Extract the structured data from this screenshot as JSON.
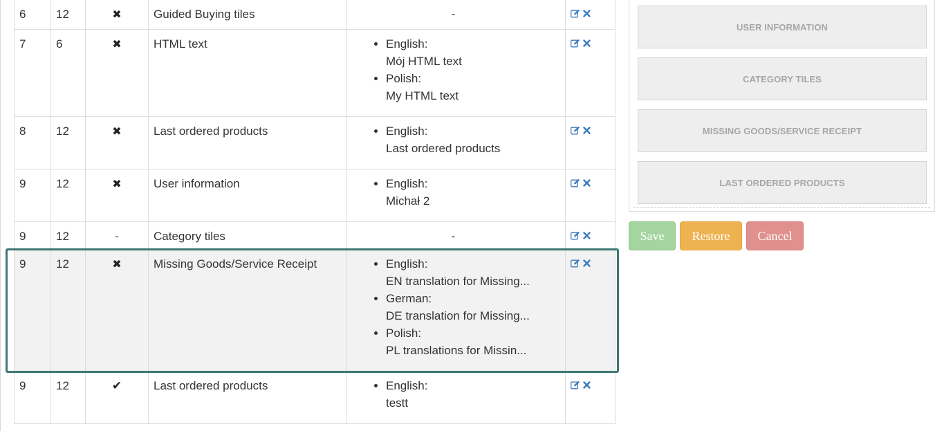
{
  "table": {
    "rows": [
      {
        "order": "6",
        "width": "12",
        "visible": "cross",
        "name": "Guided Buying tiles",
        "translations": [],
        "empty_text": "-"
      },
      {
        "order": "7",
        "width": "6",
        "visible": "cross",
        "name": "HTML text",
        "translations": [
          {
            "lang": "English:",
            "text": "Mój HTML text"
          },
          {
            "lang": "Polish:",
            "text": "My HTML text"
          }
        ]
      },
      {
        "order": "8",
        "width": "12",
        "visible": "cross",
        "name": "Last ordered products",
        "translations": [
          {
            "lang": "English:",
            "text": "Last ordered products"
          }
        ]
      },
      {
        "order": "9",
        "width": "12",
        "visible": "cross",
        "name": "User information",
        "translations": [
          {
            "lang": "English:",
            "text": "Michał 2"
          }
        ]
      },
      {
        "order": "9",
        "width": "12",
        "visible": "-",
        "name": "Category tiles",
        "translations": [],
        "empty_text": "-"
      },
      {
        "order": "9",
        "width": "12",
        "visible": "cross",
        "name": "Missing Goods/Service Receipt",
        "selected": true,
        "translations": [
          {
            "lang": "English:",
            "text": "EN translation for Missing..."
          },
          {
            "lang": "German:",
            "text": "DE translation for Missing..."
          },
          {
            "lang": "Polish:",
            "text": "PL translations for Missin..."
          }
        ]
      },
      {
        "order": "9",
        "width": "12",
        "visible": "check",
        "name": "Last ordered products",
        "translations": [
          {
            "lang": "English:",
            "text": "testt"
          }
        ]
      }
    ],
    "icons": {
      "edit": "edit-icon",
      "delete": "delete-icon",
      "cross": "cross-icon",
      "check": "check-icon"
    },
    "colors": {
      "icon_blue": "#3a7bbf",
      "highlight": "#3e7774"
    }
  },
  "panel": {
    "tiles": [
      "USER INFORMATION",
      "CATEGORY TILES",
      "MISSING GOODS/SERVICE RECEIPT",
      "LAST ORDERED PRODUCTS"
    ]
  },
  "buttons": {
    "save": "Save",
    "restore": "Restore",
    "cancel": "Cancel",
    "colors": {
      "save": "#a4d49f",
      "restore": "#efb250",
      "cancel": "#e0908d"
    }
  }
}
